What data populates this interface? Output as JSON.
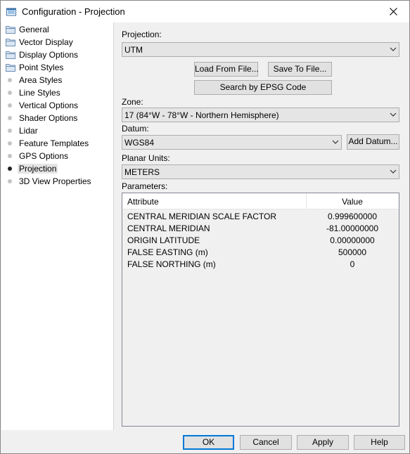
{
  "window": {
    "title": "Configuration - Projection"
  },
  "nav": [
    {
      "label": "General",
      "kind": "folder"
    },
    {
      "label": "Vector Display",
      "kind": "folder"
    },
    {
      "label": "Display Options",
      "kind": "folder"
    },
    {
      "label": "Point Styles",
      "kind": "folder"
    },
    {
      "label": "Area Styles",
      "kind": "dot"
    },
    {
      "label": "Line Styles",
      "kind": "dot"
    },
    {
      "label": "Vertical Options",
      "kind": "dot"
    },
    {
      "label": "Shader Options",
      "kind": "dot"
    },
    {
      "label": "Lidar",
      "kind": "dot"
    },
    {
      "label": "Feature Templates",
      "kind": "dot"
    },
    {
      "label": "GPS Options",
      "kind": "dot"
    },
    {
      "label": "Projection",
      "kind": "dot",
      "selected": true
    },
    {
      "label": "3D View Properties",
      "kind": "dot"
    }
  ],
  "form": {
    "projection_label": "Projection:",
    "projection_value": "UTM",
    "load_button": "Load From File...",
    "save_button": "Save To File...",
    "epsg_button": "Search by EPSG Code",
    "zone_label": "Zone:",
    "zone_value": "17 (84°W - 78°W - Northern Hemisphere)",
    "datum_label": "Datum:",
    "datum_value": "WGS84",
    "add_datum_button": "Add Datum...",
    "units_label": "Planar Units:",
    "units_value": "METERS",
    "parameters_label": "Parameters:"
  },
  "parameters": {
    "headers": {
      "attribute": "Attribute",
      "value": "Value"
    },
    "rows": [
      {
        "attribute": "CENTRAL MERIDIAN SCALE FACTOR",
        "value": "0.999600000"
      },
      {
        "attribute": "CENTRAL MERIDIAN",
        "value": "-81.00000000"
      },
      {
        "attribute": "ORIGIN LATITUDE",
        "value": "0.00000000"
      },
      {
        "attribute": "FALSE EASTING (m)",
        "value": "500000"
      },
      {
        "attribute": "FALSE NORTHING (m)",
        "value": "0"
      }
    ]
  },
  "footer": {
    "ok": "OK",
    "cancel": "Cancel",
    "apply": "Apply",
    "help": "Help"
  },
  "colors": {
    "accent": "#0078d7",
    "folder": "#6d8fb5"
  }
}
